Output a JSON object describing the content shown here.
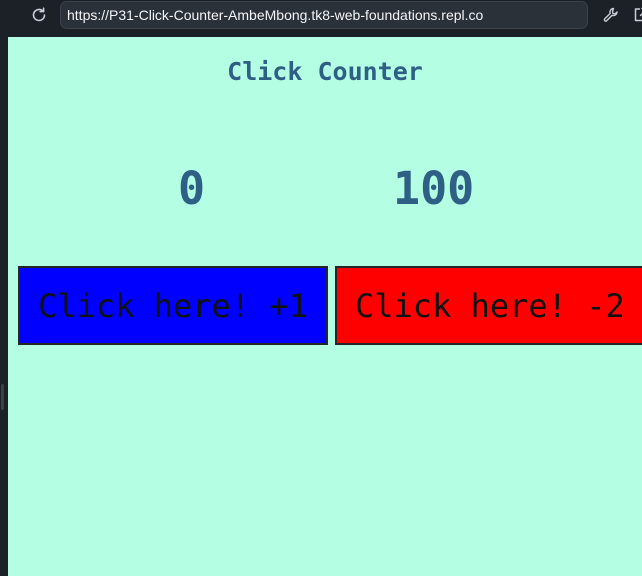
{
  "browser": {
    "url": "https://P31-Click-Counter-AmbeMbong.tk8-web-foundations.repl.co",
    "icons": {
      "reload": "reload-icon",
      "wrench": "wrench-icon",
      "open_new_tab": "external-link-icon"
    }
  },
  "page": {
    "title": "Click Counter",
    "counters": {
      "left_value": "0",
      "right_value": "100"
    },
    "buttons": {
      "plus_label": "Click here! +1",
      "minus_label": "Click here! -2"
    }
  },
  "colors": {
    "page_background": "#b4ffe4",
    "text": "#2e5f85",
    "plus_button": "#0000ff",
    "minus_button": "#ff0000",
    "browser_chrome": "#1c2128"
  }
}
